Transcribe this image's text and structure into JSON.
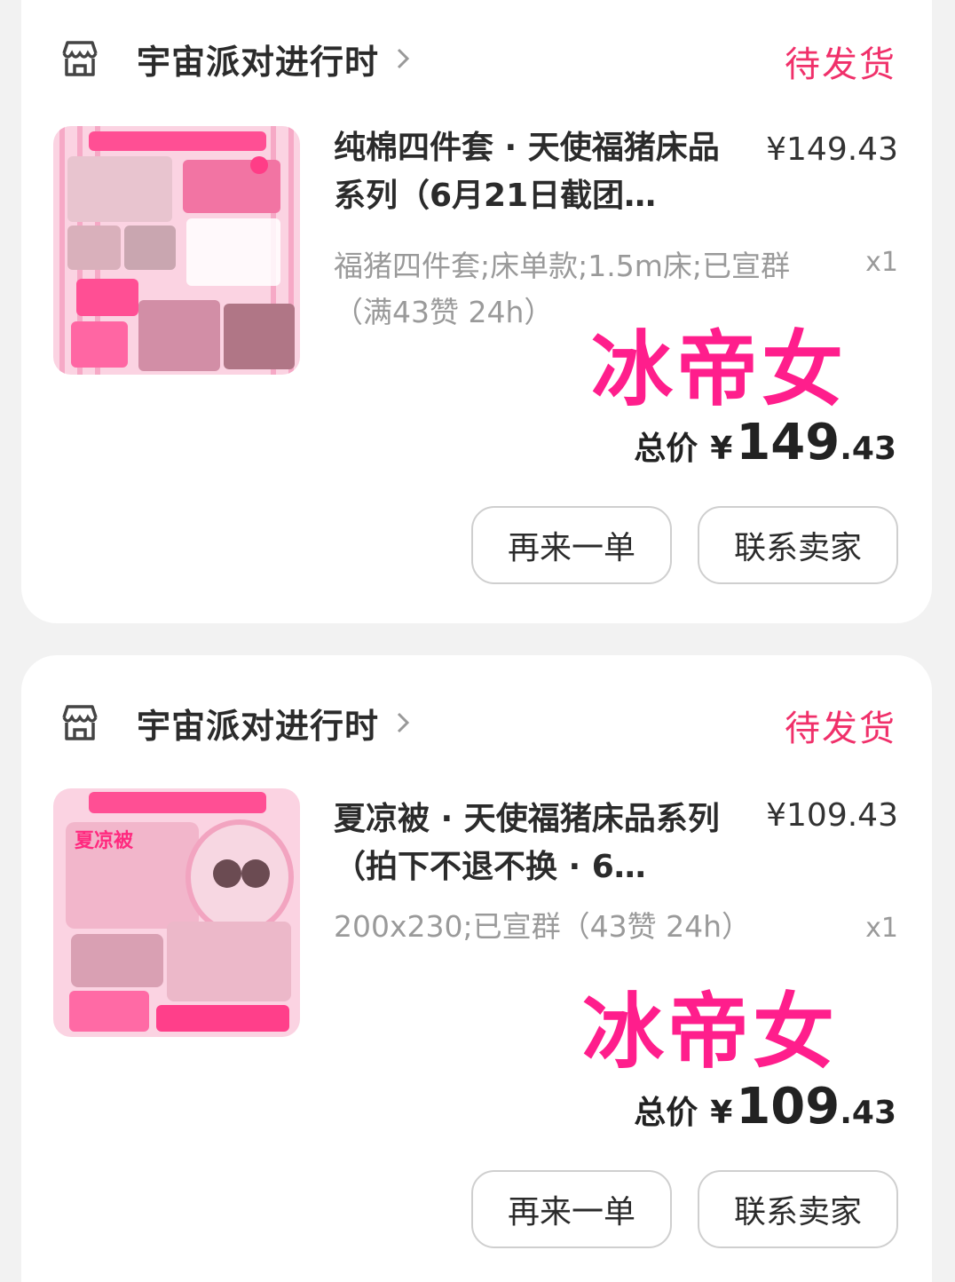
{
  "orders": [
    {
      "shop_name": "宇宙派对进行时",
      "status": "待发货",
      "title": "纯棉四件套 · 天使福猪床品系列（6月21日截团…",
      "unit_price": "¥149.43",
      "spec": "福猪四件套;床单款;1.5m床;已宣群（满43赞 24h）",
      "qty": "x1",
      "stamp": "冰帝女",
      "total_label": "总价",
      "total_yen": "¥",
      "total_int": "149",
      "total_dec": ".43",
      "reorder_label": "再来一单",
      "contact_label": "联系卖家"
    },
    {
      "shop_name": "宇宙派对进行时",
      "status": "待发货",
      "title": "夏凉被 · 天使福猪床品系列（拍下不退不换 · 6…",
      "unit_price": "¥109.43",
      "spec": "200x230;已宣群（43赞 24h）",
      "qty": "x1",
      "stamp": "冰帝女",
      "total_label": "总价",
      "total_yen": "¥",
      "total_int": "109",
      "total_dec": ".43",
      "reorder_label": "再来一单",
      "contact_label": "联系卖家"
    }
  ],
  "icons": {
    "shop": "store-icon",
    "chevron": "chevron-right-icon"
  },
  "colors": {
    "status": "#f0306a",
    "stamp": "#ff1e8c",
    "thumb_pink": "#f7b8cf"
  }
}
